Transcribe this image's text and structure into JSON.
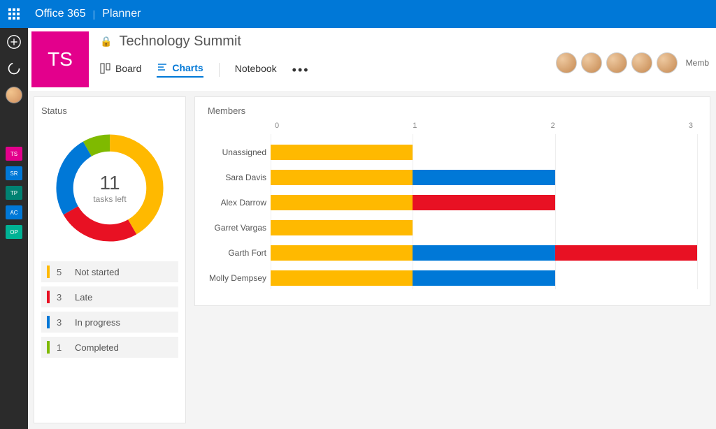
{
  "topbar": {
    "brand": "Office 365",
    "app": "Planner"
  },
  "leftrail": {
    "plans": [
      {
        "code": "TS",
        "cls": "chip-ts"
      },
      {
        "code": "SR",
        "cls": "chip-sr"
      },
      {
        "code": "TP",
        "cls": "chip-tp"
      },
      {
        "code": "AC",
        "cls": "chip-ac"
      },
      {
        "code": "OP",
        "cls": "chip-op"
      }
    ]
  },
  "header": {
    "badge": "TS",
    "title": "Technology Summit",
    "tabs": {
      "board": "Board",
      "charts": "Charts",
      "notebook": "Notebook"
    },
    "members_label": "Memb"
  },
  "status": {
    "title": "Status",
    "center_number": "11",
    "center_label": "tasks left",
    "legend": [
      {
        "count": "5",
        "label": "Not started",
        "color": "#ffb900"
      },
      {
        "count": "3",
        "label": "Late",
        "color": "#e81123"
      },
      {
        "count": "3",
        "label": "In progress",
        "color": "#0078d7"
      },
      {
        "count": "1",
        "label": "Completed",
        "color": "#7fba00"
      }
    ]
  },
  "members_chart": {
    "title": "Members",
    "axis": [
      "0",
      "1",
      "2",
      "3"
    ]
  },
  "chart_data": [
    {
      "type": "pie",
      "title": "Status",
      "series": [
        {
          "name": "Not started",
          "value": 5,
          "color": "#ffb900"
        },
        {
          "name": "Late",
          "value": 3,
          "color": "#e81123"
        },
        {
          "name": "In progress",
          "value": 3,
          "color": "#0078d7"
        },
        {
          "name": "Completed",
          "value": 1,
          "color": "#7fba00"
        }
      ],
      "center_label": "11 tasks left"
    },
    {
      "type": "bar",
      "orientation": "horizontal",
      "stacked": true,
      "title": "Members",
      "xlabel": "",
      "xlim": [
        0,
        3
      ],
      "categories": [
        "Unassigned",
        "Sara Davis",
        "Alex Darrow",
        "Garret Vargas",
        "Garth Fort",
        "Molly Dempsey"
      ],
      "series": [
        {
          "name": "Not started",
          "color": "#ffb900",
          "values": [
            1,
            1,
            1,
            1,
            1,
            1
          ]
        },
        {
          "name": "In progress",
          "color": "#0078d7",
          "values": [
            0,
            1,
            0,
            0,
            1,
            1
          ]
        },
        {
          "name": "Late",
          "color": "#e81123",
          "values": [
            0,
            0,
            1,
            0,
            1,
            0
          ]
        }
      ]
    }
  ]
}
